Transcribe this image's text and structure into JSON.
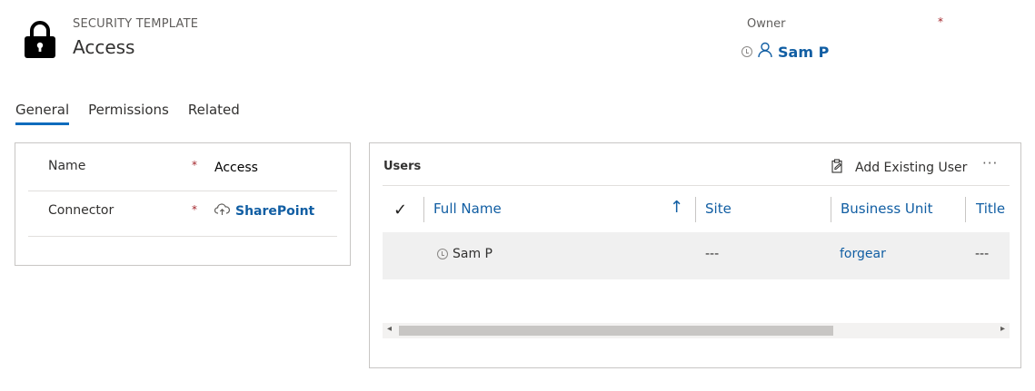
{
  "header": {
    "entity_type": "SECURITY TEMPLATE",
    "title": "Access",
    "lock_icon": "lock-icon"
  },
  "owner": {
    "label": "Owner",
    "required_mark": "*",
    "name": "Sam P"
  },
  "tabs": [
    {
      "label": "General",
      "active": true
    },
    {
      "label": "Permissions",
      "active": false
    },
    {
      "label": "Related",
      "active": false
    }
  ],
  "form": {
    "fields": [
      {
        "label": "Name",
        "required_mark": "*",
        "value": "Access"
      },
      {
        "label": "Connector",
        "required_mark": "*",
        "value": "SharePoint",
        "icon": "cloud-upload-icon"
      }
    ]
  },
  "users_grid": {
    "title": "Users",
    "add_button_label": "Add Existing User",
    "more_label": "···",
    "columns": [
      {
        "label": "Full Name",
        "sorted": "ascending"
      },
      {
        "label": "Site"
      },
      {
        "label": "Business Unit"
      },
      {
        "label": "Title"
      }
    ],
    "rows": [
      {
        "full_name": "Sam P",
        "site": "---",
        "business_unit": "forgear",
        "title": "---"
      }
    ]
  },
  "colors": {
    "accent": "#0f6cbd",
    "link": "#115ea3",
    "required": "#a4262c",
    "row_background": "#f0f0f0"
  }
}
